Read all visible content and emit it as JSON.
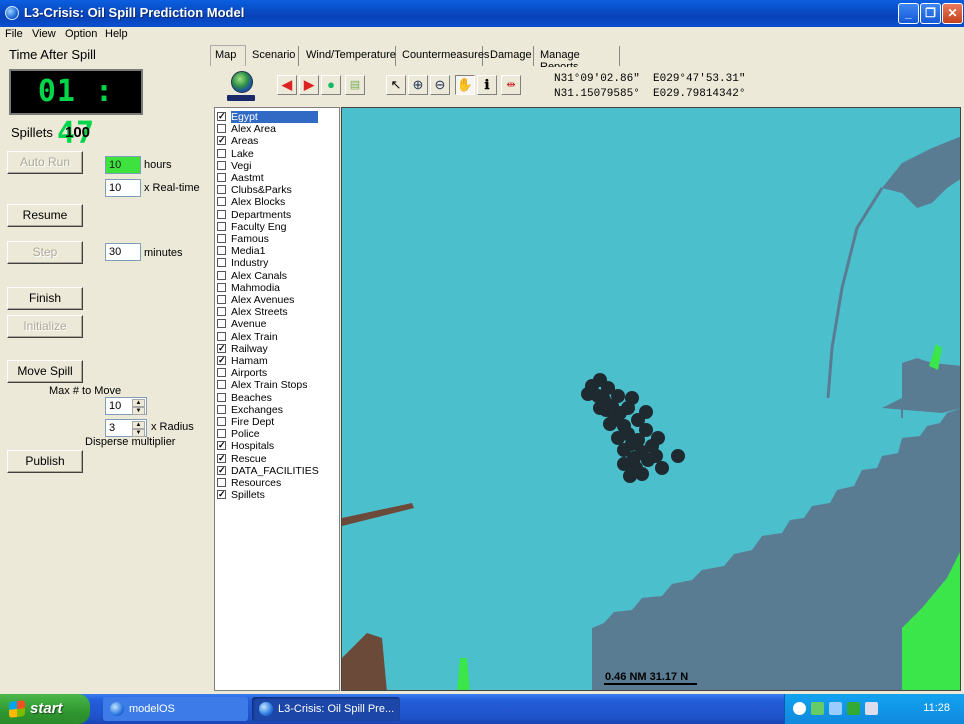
{
  "window": {
    "title": "L3-Crisis: Oil Spill Prediction Model"
  },
  "menu": [
    "File",
    "View",
    "Option",
    "Help"
  ],
  "left": {
    "time_after_spill_label": "Time After Spill",
    "time_display": "01 : 47",
    "spillets_label": "Spillets",
    "spillets_count": "100",
    "auto_run_label": "Auto Run",
    "hours_value": "10",
    "hours_label": "hours",
    "realtime_value": "10",
    "realtime_label": "x Real-time",
    "resume_label": "Resume",
    "step_label": "Step",
    "minutes_value": "30",
    "minutes_label": "minutes",
    "finish_label": "Finish",
    "initialize_label": "Initialize",
    "move_spill_label": "Move Spill",
    "max_move_label": "Max # to Move",
    "max_move_value": "10",
    "radius_value": "3",
    "radius_label": "x Radius",
    "disperse_label": "Disperse multiplier",
    "publish_label": "Publish"
  },
  "tabs": [
    "Map",
    "Scenario",
    "Wind/Temperature",
    "Countermeasures",
    "Damage",
    "Manage Reports"
  ],
  "toolbar": {
    "coords_line1": "N31°09'02.86\"  E029°47'53.31\"",
    "coords_line2": "N31.15079585°  E029.79814342°"
  },
  "layers": [
    {
      "name": "Egypt",
      "checked": true
    },
    {
      "name": "Alex Area",
      "checked": false
    },
    {
      "name": "Areas",
      "checked": true
    },
    {
      "name": "Lake",
      "checked": false
    },
    {
      "name": "Vegi",
      "checked": false
    },
    {
      "name": "Aastmt",
      "checked": false
    },
    {
      "name": "Clubs&Parks",
      "checked": false
    },
    {
      "name": "Alex Blocks",
      "checked": false
    },
    {
      "name": "Departments",
      "checked": false
    },
    {
      "name": "Faculty Eng",
      "checked": false
    },
    {
      "name": "Famous",
      "checked": false
    },
    {
      "name": "Media1",
      "checked": false
    },
    {
      "name": "Industry",
      "checked": false
    },
    {
      "name": "Alex Canals",
      "checked": false
    },
    {
      "name": "Mahmodia",
      "checked": false
    },
    {
      "name": "Alex Avenues",
      "checked": false
    },
    {
      "name": "Alex Streets",
      "checked": false
    },
    {
      "name": "Avenue",
      "checked": false
    },
    {
      "name": "Alex Train",
      "checked": false
    },
    {
      "name": "Railway",
      "checked": true
    },
    {
      "name": "Hamam",
      "checked": true
    },
    {
      "name": "Airports",
      "checked": false
    },
    {
      "name": "Alex Train Stops",
      "checked": false
    },
    {
      "name": "Beaches",
      "checked": false
    },
    {
      "name": "Exchanges",
      "checked": false
    },
    {
      "name": "Fire Dept",
      "checked": false
    },
    {
      "name": "Police",
      "checked": false
    },
    {
      "name": "Hospitals",
      "checked": true
    },
    {
      "name": "Rescue",
      "checked": true
    },
    {
      "name": "DATA_FACILITIES",
      "checked": true
    },
    {
      "name": "Resources",
      "checked": false
    },
    {
      "name": "Spillets",
      "checked": true
    }
  ],
  "map": {
    "scale_label": "0.46 NM  31.17 N",
    "colors": {
      "sea": "#4cbfcc",
      "land": "#5a7c93",
      "green": "#3be64a",
      "brown": "#6b4a3a",
      "spill": "#1e2a30"
    }
  },
  "taskbar": {
    "start_label": "start",
    "tasks": [
      "modelOS",
      "L3-Crisis: Oil Spill Pre..."
    ],
    "clock": "11:28"
  }
}
